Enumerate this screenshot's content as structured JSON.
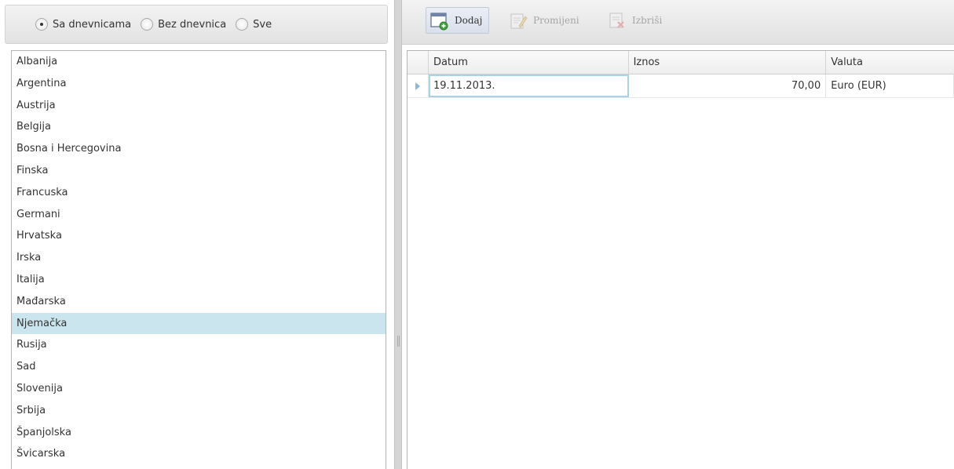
{
  "filter": {
    "options": [
      {
        "label": "Sa dnevnicama",
        "checked": true
      },
      {
        "label": "Bez dnevnica",
        "checked": false
      },
      {
        "label": "Sve",
        "checked": false
      }
    ]
  },
  "countries": {
    "selected": "Njemačka",
    "items": [
      "Albanija",
      "Argentina",
      "Austrija",
      "Belgija",
      "Bosna i Hercegovina",
      "Finska",
      "Francuska",
      "Germani",
      "Hrvatska",
      "Irska",
      "Italija",
      "Mađarska",
      "Njemačka",
      "Rusija",
      "Sad",
      "Slovenija",
      "Srbija",
      "Španjolska",
      "Švicarska"
    ]
  },
  "toolbar": {
    "add_label": "Dodaj",
    "edit_label": "Promijeni",
    "delete_label": "Izbriši"
  },
  "grid": {
    "columns": [
      "Datum",
      "Iznos",
      "Valuta"
    ],
    "rows": [
      {
        "datum": "19.11.2013.",
        "iznos": "70,00",
        "valuta": "Euro (EUR)"
      }
    ]
  },
  "colors": {
    "selected_row": "#cbe5ef",
    "accent": "#8ab8d6"
  }
}
